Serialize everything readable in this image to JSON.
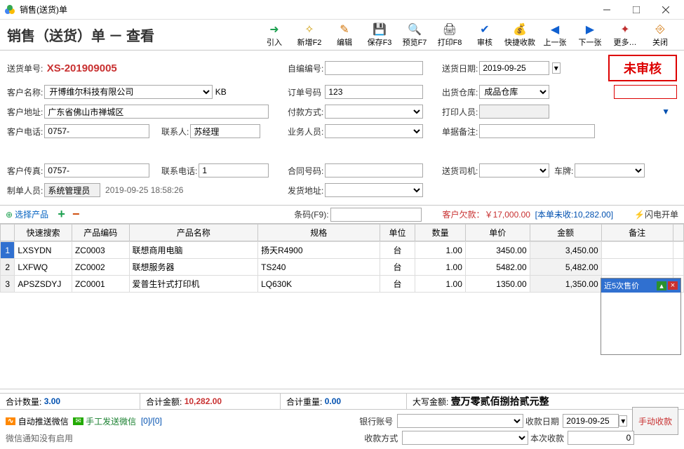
{
  "window": {
    "title": "销售(送货)单"
  },
  "header": {
    "title": "销售（送货）单 － 查看"
  },
  "toolbar": [
    {
      "id": "import",
      "label": "引入",
      "color": "#1da050",
      "glyph": "➜"
    },
    {
      "id": "new",
      "label": "新增F2",
      "color": "#d0a010",
      "glyph": "✧"
    },
    {
      "id": "edit",
      "label": "编辑",
      "color": "#d07000",
      "glyph": "✎"
    },
    {
      "id": "save",
      "label": "保存F3",
      "color": "#333",
      "glyph": "💾"
    },
    {
      "id": "preview",
      "label": "预览F7",
      "color": "#333",
      "glyph": "🔍"
    },
    {
      "id": "print",
      "label": "打印F8",
      "color": "#333",
      "glyph": "🖨"
    },
    {
      "id": "audit",
      "label": "审核",
      "color": "#1060d0",
      "glyph": "✔"
    },
    {
      "id": "quickpay",
      "label": "快捷收款",
      "color": "#d07000",
      "glyph": "💰"
    },
    {
      "id": "prev",
      "label": "上一张",
      "color": "#1060d0",
      "glyph": "◀"
    },
    {
      "id": "next",
      "label": "下一张",
      "color": "#1060d0",
      "glyph": "▶"
    },
    {
      "id": "more",
      "label": "更多…",
      "color": "#c03030",
      "glyph": "✦"
    },
    {
      "id": "close",
      "label": "关闭",
      "color": "#d07000",
      "glyph": "⎆"
    }
  ],
  "form": {
    "doc_no_label": "送货单号:",
    "doc_no": "XS-201909005",
    "self_no_label": "自编编号:",
    "self_no": "",
    "ship_date_label": "送货日期:",
    "ship_date": "2019-09-25",
    "stamp": "未审核",
    "cust_name_label": "客户名称:",
    "cust_name": "开博维尔科技有限公司",
    "cust_code": "KB",
    "order_no_label": "订单号码",
    "order_no": "123",
    "warehouse_label": "出货仓库:",
    "warehouse": "成品仓库",
    "cust_addr_label": "客户地址:",
    "cust_addr": "广东省佛山市禅城区",
    "pay_method_label": "付款方式:",
    "pay_method": "",
    "printer_label": "打印人员:",
    "printer": "",
    "cust_tel_label": "客户电话:",
    "cust_tel": "0757-",
    "contact_label": "联系人:",
    "contact": "苏经理",
    "sales_label": "业务人员:",
    "sales": "",
    "remark_label": "单据备注:",
    "remark": "",
    "cust_fax_label": "客户传真:",
    "cust_fax": "0757-",
    "contact_tel_label": "联系电话:",
    "contact_tel": "1",
    "contract_label": "合同号码:",
    "contract": "",
    "driver_label": "送货司机:",
    "driver": "",
    "plate_label": "车牌:",
    "plate": "",
    "maker_label": "制单人员:",
    "maker": "系统管理员",
    "make_time": "2019-09-25 18:58:26",
    "delivery_addr_label": "发货地址:",
    "delivery_addr": ""
  },
  "actions": {
    "select_product": "选择产品",
    "barcode_label": "条码(F9):",
    "debt_label": "客户欠款：",
    "debt_amount": "￥17,000.00",
    "unpaid_label": "[本单未收: ",
    "unpaid_amount": "10,282.00",
    "unpaid_suffix": "]",
    "flash_open": "闪电开单"
  },
  "grid": {
    "headers": [
      "",
      "快速搜索",
      "产品编码",
      "产品名称",
      "规格",
      "单位",
      "数量",
      "单价",
      "金额",
      "备注",
      ""
    ],
    "rows": [
      {
        "n": "1",
        "search": "LXSYDN",
        "code": "ZC0003",
        "name": "联想商用电脑",
        "spec": "扬天R4900",
        "unit": "台",
        "qty": "1.00",
        "price": "3450.00",
        "amount": "3,450.00",
        "note": ""
      },
      {
        "n": "2",
        "search": "LXFWQ",
        "code": "ZC0002",
        "name": "联想服务器",
        "spec": "TS240",
        "unit": "台",
        "qty": "1.00",
        "price": "5482.00",
        "amount": "5,482.00",
        "note": ""
      },
      {
        "n": "3",
        "search": "APSZSDYJ",
        "code": "ZC0001",
        "name": "爱普生针式打印机",
        "spec": "LQ630K",
        "unit": "台",
        "qty": "1.00",
        "price": "1350.00",
        "amount": "1,350.00",
        "note": ""
      }
    ]
  },
  "side_popup": {
    "title": "近5次售价"
  },
  "totals": {
    "qty_label": "合计数量:",
    "qty": "3.00",
    "amt_label": "合计金额:",
    "amt": "10,282.00",
    "wt_label": "合计重量:",
    "wt": "0.00",
    "cn_label": "大写金额:",
    "cn": "壹万零贰佰捌拾贰元整"
  },
  "footer": {
    "auto_wechat": "自动推送微信",
    "manual_wechat": "手工发送微信",
    "wechat_count": "[0]/[0]",
    "bank_label": "银行账号",
    "recv_date_label": "收款日期",
    "recv_date": "2019-09-25",
    "manual_recv": "手动收款",
    "wechat_status": "微信通知没有启用",
    "recv_method_label": "收款方式",
    "this_recv_label": "本次收款",
    "this_recv": "0"
  }
}
